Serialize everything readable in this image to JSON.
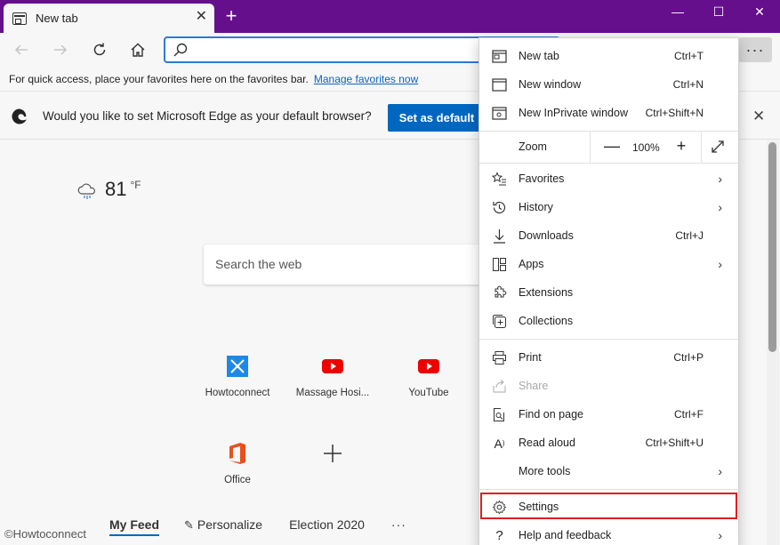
{
  "tab": {
    "title": "New tab"
  },
  "toolbar": {
    "more_label": "···"
  },
  "favbar": {
    "text": "For quick access, place your favorites here on the favorites bar.",
    "link": "Manage favorites now"
  },
  "banner": {
    "text": "Would you like to set Microsoft Edge as your default browser?",
    "button": "Set as default"
  },
  "weather": {
    "temp": "81",
    "unit": "°F"
  },
  "search": {
    "placeholder": "Search the web"
  },
  "tiles": [
    {
      "label": "Howtoconnect",
      "icon": "howtoconnect-icon"
    },
    {
      "label": "Massage Hosi...",
      "icon": "youtube-icon"
    },
    {
      "label": "YouTube",
      "icon": "youtube-icon"
    },
    {
      "label": "Office",
      "icon": "office-icon"
    },
    {
      "label": "",
      "icon": "add-icon"
    }
  ],
  "feed": {
    "tabs": [
      "My Feed",
      "Personalize",
      "Election 2020"
    ],
    "more": "···"
  },
  "watermark": "©Howtoconnect",
  "menu": {
    "new_tab": {
      "label": "New tab",
      "shortcut": "Ctrl+T"
    },
    "new_window": {
      "label": "New window",
      "shortcut": "Ctrl+N"
    },
    "new_inprivate": {
      "label": "New InPrivate window",
      "shortcut": "Ctrl+Shift+N"
    },
    "zoom": {
      "label": "Zoom",
      "value": "100%",
      "minus": "—",
      "plus": "+"
    },
    "favorites": {
      "label": "Favorites"
    },
    "history": {
      "label": "History"
    },
    "downloads": {
      "label": "Downloads",
      "shortcut": "Ctrl+J"
    },
    "apps": {
      "label": "Apps"
    },
    "extensions": {
      "label": "Extensions"
    },
    "collections": {
      "label": "Collections"
    },
    "print": {
      "label": "Print",
      "shortcut": "Ctrl+P"
    },
    "share": {
      "label": "Share"
    },
    "find": {
      "label": "Find on page",
      "shortcut": "Ctrl+F"
    },
    "read_aloud": {
      "label": "Read aloud",
      "shortcut": "Ctrl+Shift+U"
    },
    "more_tools": {
      "label": "More tools"
    },
    "settings": {
      "label": "Settings"
    },
    "help": {
      "label": "Help and feedback"
    }
  },
  "colors": {
    "titlebar": "#660f8c",
    "accent": "#0067c0",
    "highlight": "#e01e1e"
  }
}
